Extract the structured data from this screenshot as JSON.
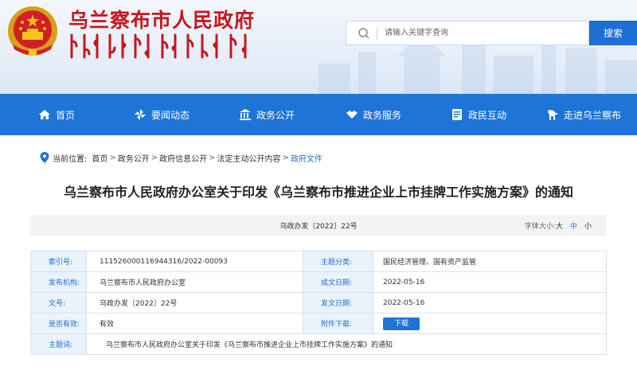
{
  "header": {
    "site_title": "乌兰察布市人民政府",
    "search_placeholder": "请输入关键字查询",
    "search_button": "搜索"
  },
  "nav": [
    {
      "label": "首页",
      "icon": "home-icon"
    },
    {
      "label": "要闻动态",
      "icon": "pinwheel-icon"
    },
    {
      "label": "政务公开",
      "icon": "building-icon"
    },
    {
      "label": "政务服务",
      "icon": "handshake-icon"
    },
    {
      "label": "政民互动",
      "icon": "id-card-icon"
    },
    {
      "label": "走进乌兰察布",
      "icon": "horse-icon"
    }
  ],
  "breadcrumb": {
    "prefix": "当前位置:",
    "items": [
      "首页",
      "政务公开",
      "政府信息公开",
      "法定主动公开内容",
      "政府文件"
    ],
    "separator": ">"
  },
  "document": {
    "title": "乌兰察布市人民政府办公室关于印发《乌兰察布市推进企业上市挂牌工作实施方案》的通知",
    "doc_number": "乌政办发〔2022〕22号",
    "font_size_label": "字体大小:",
    "font_sizes": [
      "大",
      "中",
      "小"
    ]
  },
  "info": {
    "index_label": "索引号:",
    "index_value": "11152600011694431​6/2022-00093",
    "category_label": "主题分类:",
    "category_value": "国民经济管理、国有资产监管",
    "issuer_label": "发布机构:",
    "issuer_value": "乌兰察布市人民政府办公室",
    "created_label": "成文日期:",
    "created_value": "2022-05-16",
    "docno_label": "文号:",
    "docno_value": "乌政办发〔2022〕22号",
    "published_label": "发文日期:",
    "published_value": "2022-05-16",
    "valid_label": "是否有效:",
    "valid_value": "有效",
    "attachment_label": "附件下载:",
    "attachment_button": "下载",
    "topic_label": "主题词:",
    "topic_value": "乌兰察布市人民政府办公室关于印发《乌兰察布市推进企业上市挂牌工作实施方案》的通知"
  },
  "colors": {
    "brand_red": "#c8161d",
    "nav_blue": "#1f74d8",
    "label_blue": "#1f6fcf",
    "label_bg": "#eaf2fc"
  }
}
